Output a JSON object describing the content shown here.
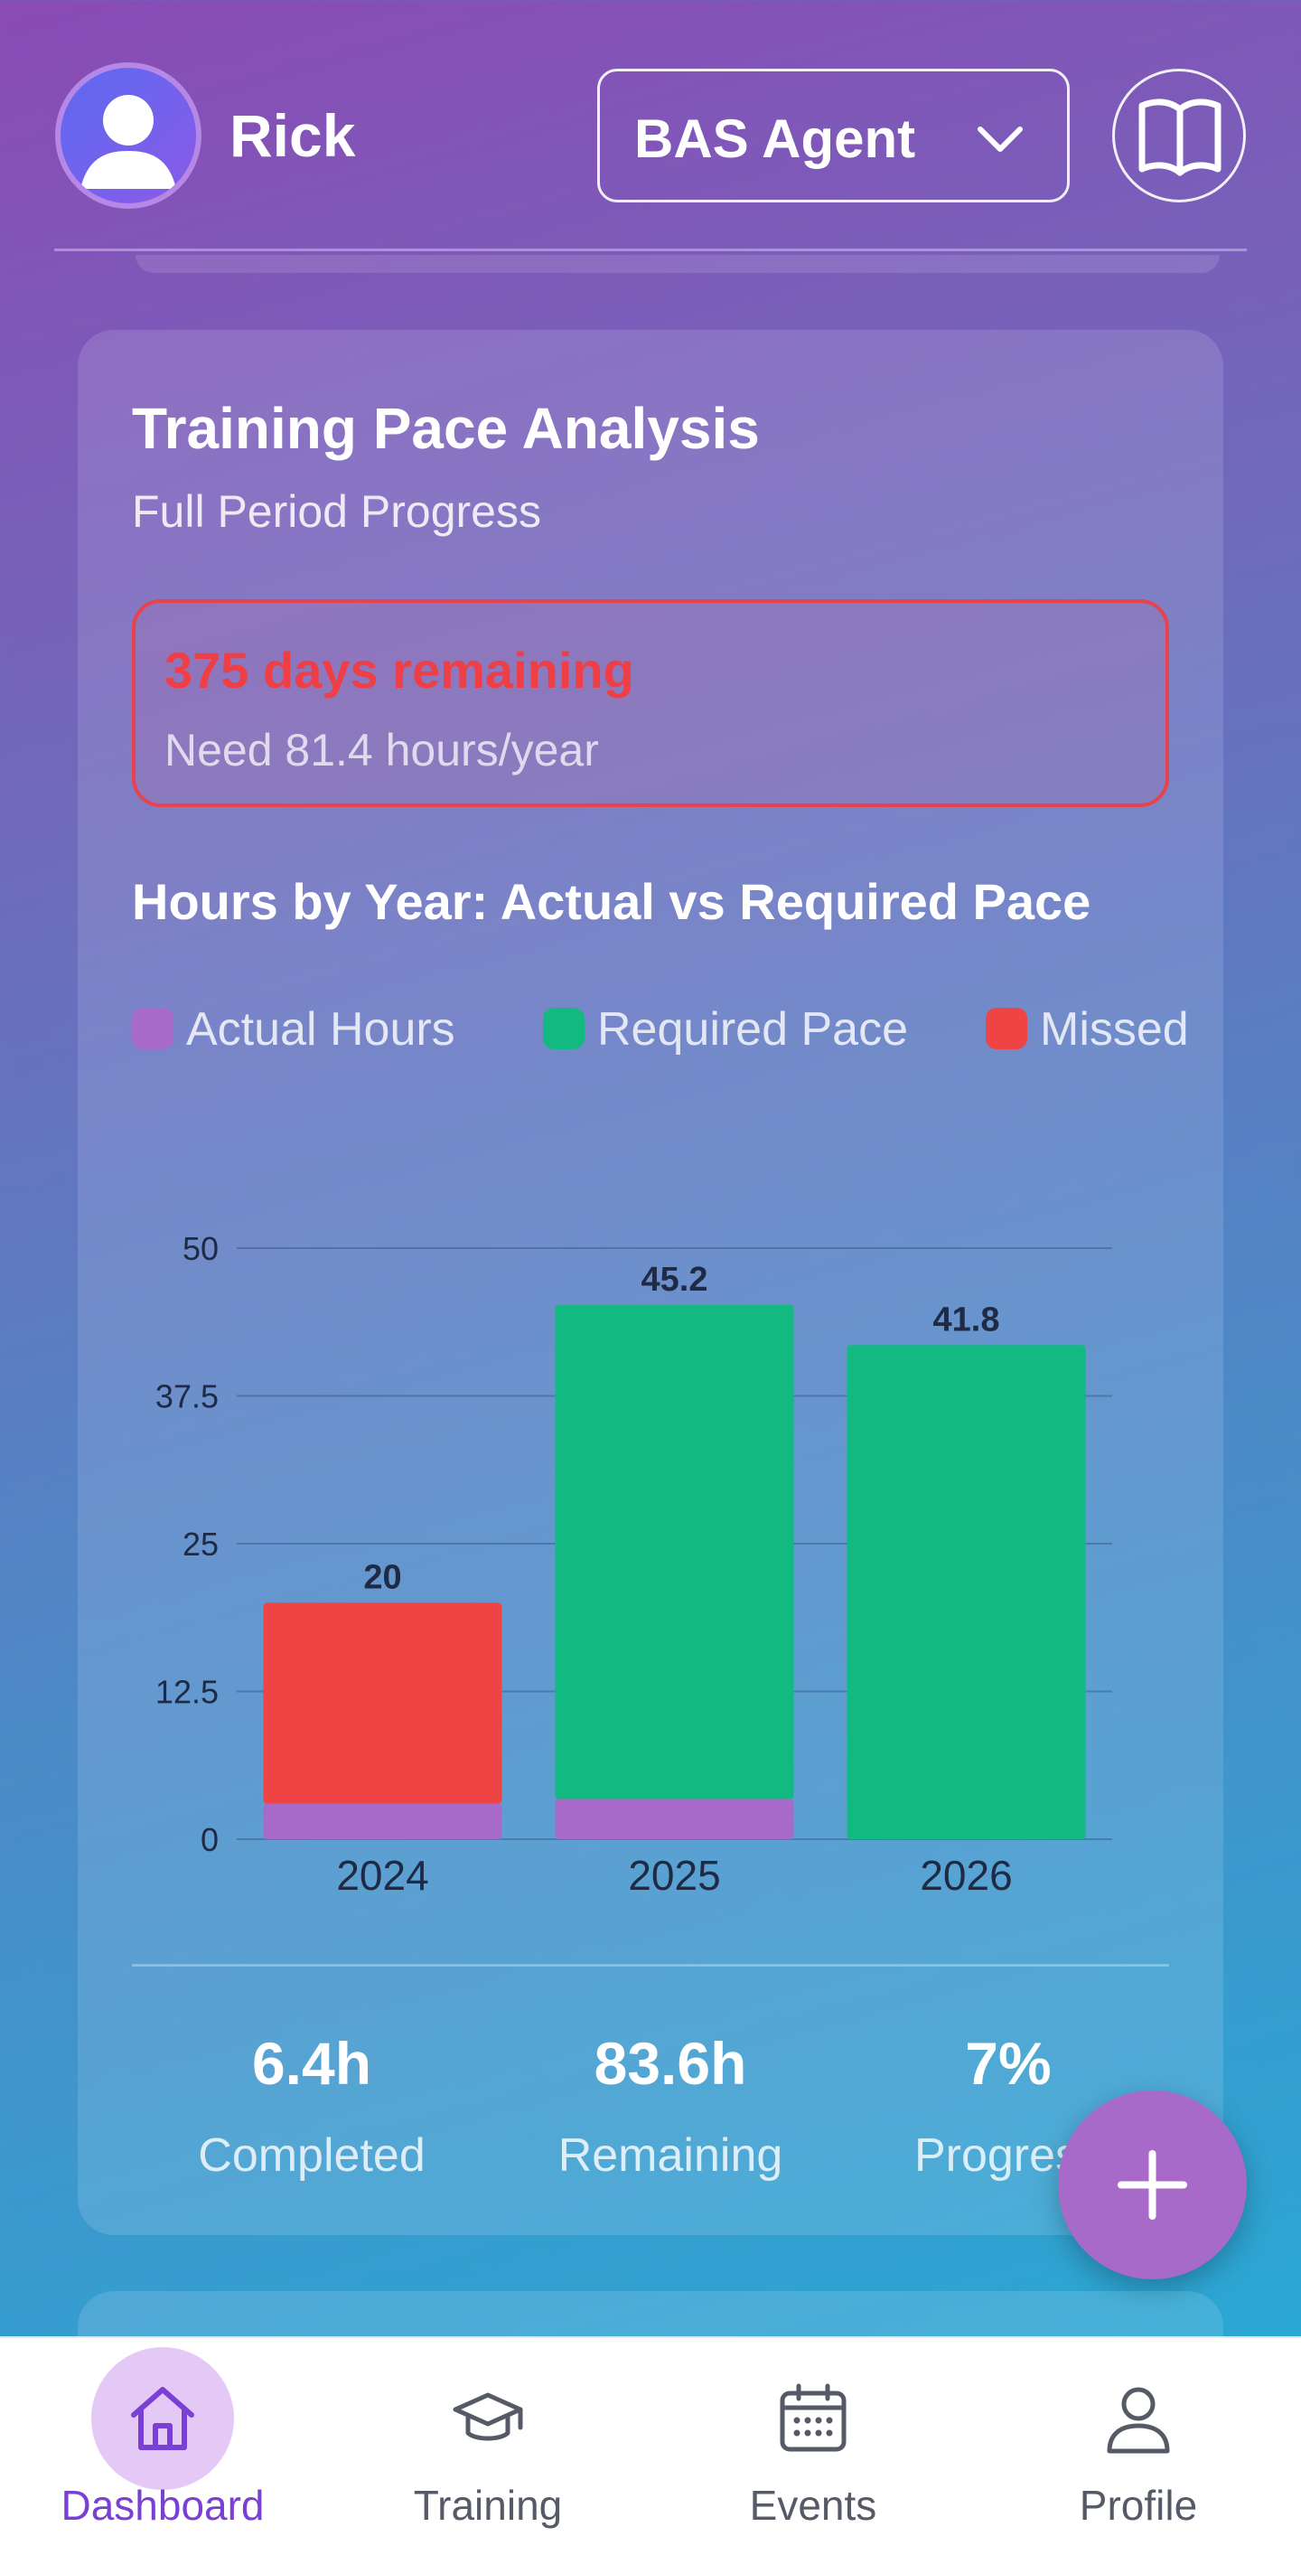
{
  "header": {
    "username": "Rick",
    "agent_select": {
      "selected": "BAS Agent",
      "icon": "chevron-down-icon"
    },
    "book_button_icon": "book-open-icon",
    "avatar_icon": "user-avatar-icon"
  },
  "card": {
    "title": "Training Pace Analysis",
    "subtitle": "Full Period Progress",
    "alert": {
      "main": "375 days remaining",
      "sub": "Need 81.4 hours/year"
    },
    "chart_title": "Hours by Year: Actual vs Required Pace",
    "legend": [
      {
        "label": "Actual Hours",
        "color": "#a86ac8"
      },
      {
        "label": "Required Pace",
        "color": "#12b981"
      },
      {
        "label": "Missed",
        "color": "#ef4444"
      }
    ],
    "stats": [
      {
        "value": "6.4h",
        "label": "Completed"
      },
      {
        "value": "83.6h",
        "label": "Remaining"
      },
      {
        "value": "7%",
        "label": "Progress"
      }
    ]
  },
  "chart_data": {
    "type": "bar",
    "stacked": true,
    "title": "Hours by Year: Actual vs Required Pace",
    "xlabel": "",
    "ylabel": "",
    "categories": [
      "2024",
      "2025",
      "2026"
    ],
    "ylim": [
      0,
      50
    ],
    "yticks": [
      "0",
      "12.5",
      "25",
      "37.5",
      "50"
    ],
    "grid": true,
    "legend_position": "top",
    "series": [
      {
        "name": "Actual Hours",
        "color": "#a86ac8",
        "values": [
          3.0,
          3.4,
          0
        ]
      },
      {
        "name": "Required Pace",
        "color": "#12b981",
        "values": [
          0,
          41.8,
          41.8
        ]
      },
      {
        "name": "Missed",
        "color": "#ef4444",
        "values": [
          17.0,
          0,
          0
        ]
      }
    ],
    "totals_labels": [
      "20",
      "45.2",
      "41.8"
    ]
  },
  "fab": {
    "icon": "plus-icon"
  },
  "nav": {
    "items": [
      {
        "label": "Dashboard",
        "icon": "home-icon",
        "active": true
      },
      {
        "label": "Training",
        "icon": "graduation-cap-icon",
        "active": false
      },
      {
        "label": "Events",
        "icon": "calendar-icon",
        "active": false
      },
      {
        "label": "Profile",
        "icon": "person-icon",
        "active": false
      }
    ]
  }
}
